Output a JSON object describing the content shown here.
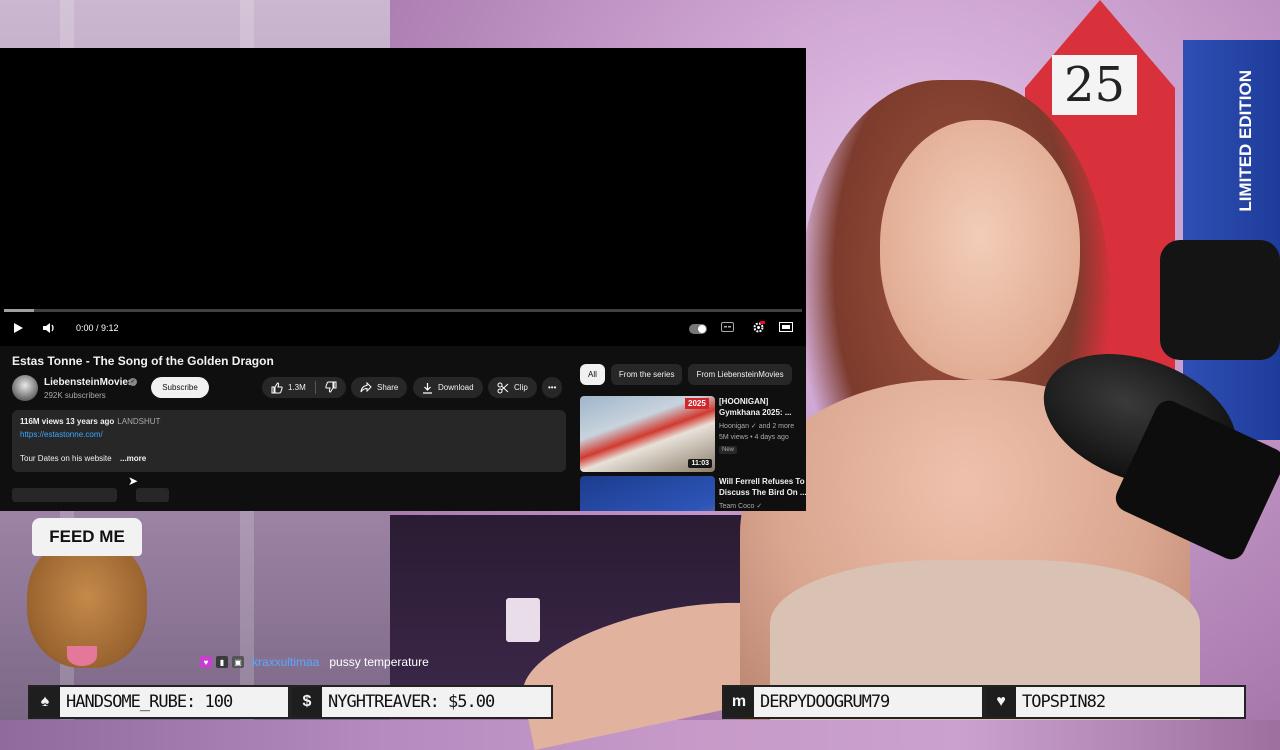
{
  "scene": {
    "sign_number": "25",
    "box_text": "LIMITED EDITION"
  },
  "youtube": {
    "player": {
      "time": "0:00 / 9:12",
      "progress": 0
    },
    "video": {
      "title": "Estas Tonne - The Song of the Golden Dragon",
      "channel": "LiebensteinMovies",
      "subscribers": "292K subscribers",
      "subscribe_label": "Subscribe",
      "likes": "1.3M",
      "share_label": "Share",
      "download_label": "Download",
      "clip_label": "Clip",
      "more_actions": "•••"
    },
    "description": {
      "views_date": "116M views  13 years ago",
      "location": "LANDSHUT",
      "link": "https://estastonne.com/",
      "text": "Tour Dates on his website",
      "more": "...more"
    },
    "chips": [
      "All",
      "From the series",
      "From LiebensteinMovies"
    ],
    "recommendations": [
      {
        "title": "[HOONIGAN] Gymkhana 2025: ...",
        "channel": "Hoonigan ✓ and 2 more",
        "stats": "5M views • 4 days ago",
        "badge": "New",
        "duration": "11:03",
        "thumb_badge": "2025"
      },
      {
        "title": "Will Ferrell Refuses To Discuss The Bird On ...",
        "channel": "Team Coco ✓",
        "stats": "",
        "badge": "",
        "duration": "",
        "thumb_badge": ""
      }
    ]
  },
  "overlay": {
    "dog_hat": "FEED ME",
    "chat": {
      "username": "kraxxultimaa",
      "message": "pussy temperature"
    },
    "ticker": [
      {
        "icon": "spade-icon",
        "glyph": "♠",
        "text": "HANDSOME_RUBE: 100"
      },
      {
        "icon": "dollar-icon",
        "glyph": "$",
        "text": "NYGHTREAVER: $5.00"
      },
      {
        "icon": "m-icon",
        "glyph": "m",
        "text": "DERPYDOOGRUM79"
      },
      {
        "icon": "heart-icon",
        "glyph": "♥",
        "text": "TOPSPIN82"
      }
    ]
  },
  "colors": {
    "accent": "#ff0033",
    "link": "#3ea6ff",
    "chat_user": "#5aa8ff"
  }
}
